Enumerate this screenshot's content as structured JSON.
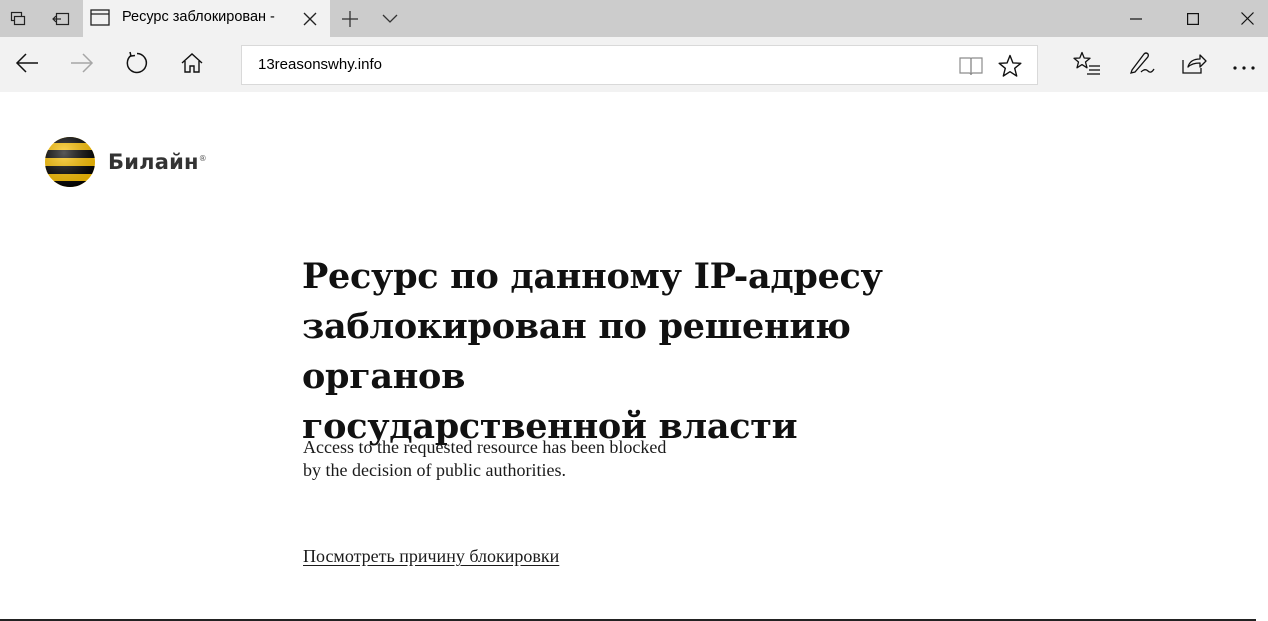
{
  "browser": {
    "tab": {
      "title": "Ресурс заблокирован -"
    },
    "address_bar": {
      "url": "13reasonswhy.info"
    },
    "icons": {
      "set_aside_tabs": "tabs-aside-icon",
      "show_tabs": "show-tabs-icon",
      "tab_page": "page-icon",
      "tab_close": "close-icon",
      "new_tab": "plus-icon",
      "tab_preview": "chevron-down-icon",
      "minimize": "minimize-icon",
      "maximize": "maximize-icon",
      "window_close": "close-icon",
      "back": "arrow-left-icon",
      "forward": "arrow-right-icon",
      "refresh": "refresh-icon",
      "home": "home-icon",
      "reading_view": "book-icon",
      "favorite": "star-icon",
      "hub": "favorites-list-icon",
      "notes": "pen-icon",
      "share": "share-icon",
      "more": "more-icon"
    }
  },
  "page": {
    "logo": {
      "text": "Билайн",
      "mark": "®",
      "colors": {
        "yellow": "#ffc300",
        "black": "#000000"
      }
    },
    "headline": {
      "line1": "Ресурс по данному IP-адресу",
      "line2": "заблокирован по решению органов",
      "line3": "государственной власти"
    },
    "subtext": {
      "line1": "Access to the requested resource has been blocked",
      "line2": "by the decision of public authorities."
    },
    "reason_link": "Посмотреть причину блокировки"
  }
}
